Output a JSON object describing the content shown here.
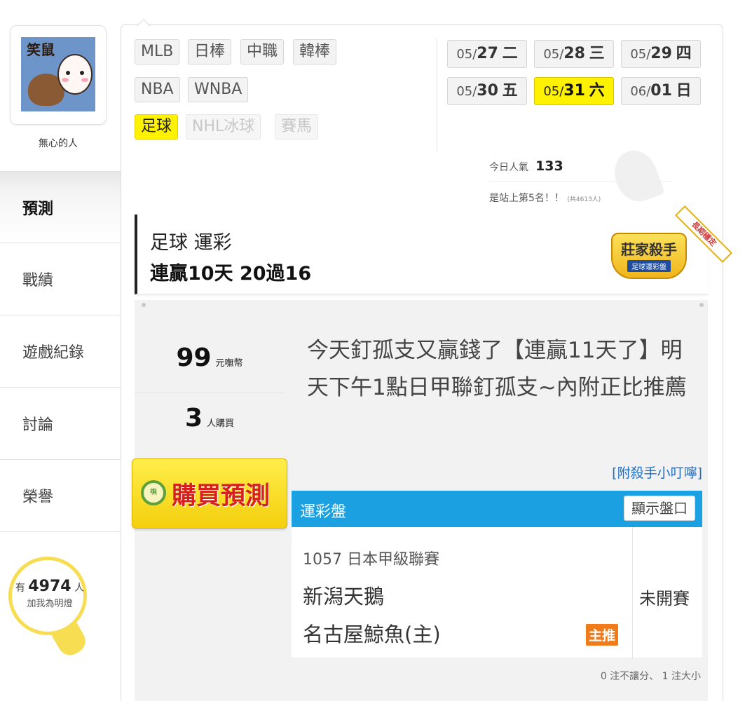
{
  "profile": {
    "avatar_text": "笑鼠",
    "username": "無心的人"
  },
  "nav": [
    {
      "label": "預測",
      "active": true
    },
    {
      "label": "戰績",
      "active": false
    },
    {
      "label": "遊戲紀錄",
      "active": false
    },
    {
      "label": "討論",
      "active": false
    },
    {
      "label": "榮譽",
      "active": false
    }
  ],
  "fans": {
    "prefix": "有",
    "count": "4974",
    "suffix": "人",
    "label": "加我為明燈"
  },
  "leagues": [
    {
      "label": "MLB",
      "state": "normal"
    },
    {
      "label": "日棒",
      "state": "normal"
    },
    {
      "label": "中職",
      "state": "normal"
    },
    {
      "label": "韓棒",
      "state": "normal"
    },
    {
      "label": "NBA",
      "state": "normal"
    },
    {
      "label": "WNBA",
      "state": "normal"
    },
    {
      "label": "足球",
      "state": "active"
    },
    {
      "label": "NHL冰球",
      "state": "disabled"
    },
    {
      "label": "賽馬",
      "state": "disabled"
    }
  ],
  "dates": [
    {
      "month": "05/",
      "day": "27",
      "weekday": "二",
      "active": false
    },
    {
      "month": "05/",
      "day": "28",
      "weekday": "三",
      "active": false
    },
    {
      "month": "05/",
      "day": "29",
      "weekday": "四",
      "active": false
    },
    {
      "month": "05/",
      "day": "30",
      "weekday": "五",
      "active": false
    },
    {
      "month": "05/",
      "day": "31",
      "weekday": "六",
      "active": true
    },
    {
      "month": "06/",
      "day": "01",
      "weekday": "日",
      "active": false
    }
  ],
  "popularity": {
    "label": "今日人氣",
    "value": "133",
    "rank_text": "是站上第5名！！",
    "rank_total": "(共4613人)"
  },
  "banner": {
    "line1": "足球 運彩",
    "line2": "連贏10天 20過16",
    "badge_title": "莊家殺手",
    "badge_sub": "足球運彩盤",
    "ribbon": "長期穩定"
  },
  "prediction": {
    "price_value": "99",
    "price_unit": "元嘸幣",
    "buyers_value": "3",
    "buyers_unit": "人購買",
    "text": "今天釘孤支又贏錢了【連贏11天了】明天下午1點日甲聯釘孤支~內附正比推薦",
    "buy_label": "購買預測",
    "coin_text": "嘸",
    "tip_link": "[附殺手小叮嚀]"
  },
  "odds": {
    "title": "運彩盤",
    "show_button": "顯示盤口",
    "match_league": "1057 日本甲級聯賽",
    "team_away": "新潟天鵝",
    "team_home": "名古屋鯨魚(主)",
    "main_tag": "主推",
    "status": "未開賽",
    "summary": "0 注不讓分、 1 注大小"
  },
  "colors": {
    "accent_yellow": "#fff200",
    "odds_blue": "#1ba0e1",
    "buy_red": "#d62020",
    "tag_orange": "#f07b1a",
    "link_blue": "#1f6fc7"
  }
}
